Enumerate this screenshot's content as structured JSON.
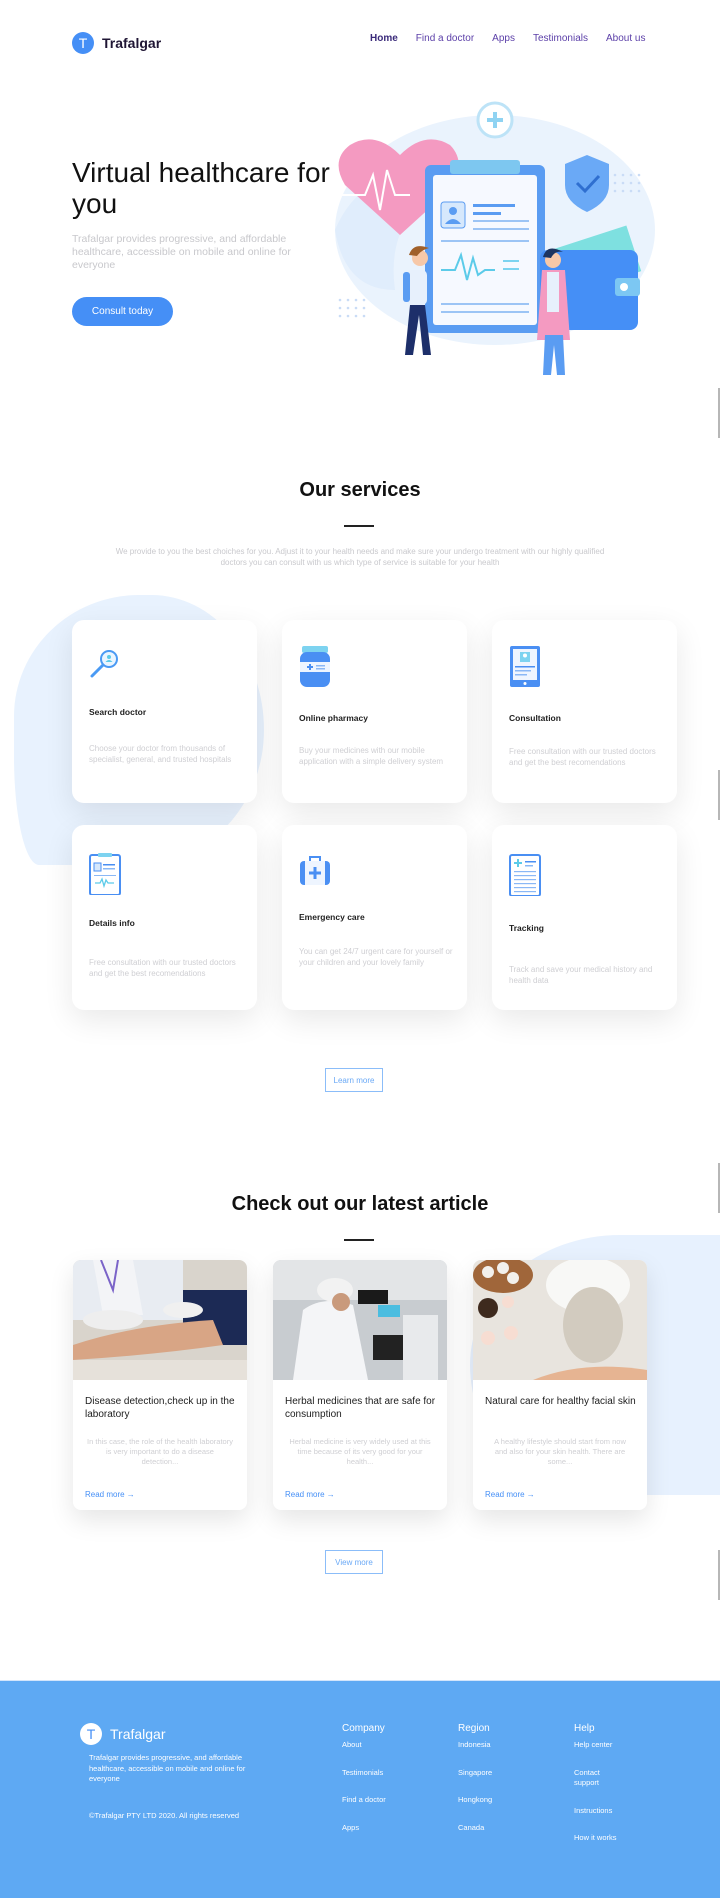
{
  "header": {
    "logo_letter": "T",
    "brand": "Trafalgar",
    "nav": [
      {
        "label": "Home",
        "active": true
      },
      {
        "label": "Find a doctor",
        "active": false
      },
      {
        "label": "Apps",
        "active": false
      },
      {
        "label": "Testimonials",
        "active": false
      },
      {
        "label": "About us",
        "active": false
      }
    ]
  },
  "hero": {
    "title": "Virtual healthcare for you",
    "subtitle": "Trafalgar provides progressive, and affordable healthcare, accessible on mobile and online for everyone",
    "cta": "Consult today",
    "illustration": "doctor-and-patient-clipboard-illustration"
  },
  "services": {
    "title": "Our services",
    "description": "We provide to you the best choiches for you. Adjust it to your health needs and make sure your undergo treatment with our highly qualified doctors you can consult with us which type of service is suitable for your health",
    "cards": [
      {
        "icon": "search-doctor-icon",
        "title": "Search doctor",
        "desc": "Choose your doctor from thousands of specialist, general, and trusted hospitals"
      },
      {
        "icon": "pharmacy-bottle-icon",
        "title": "Online pharmacy",
        "desc": "Buy your medicines with our mobile application with a simple delivery system"
      },
      {
        "icon": "tablet-consultation-icon",
        "title": "Consultation",
        "desc": "Free consultation with our trusted doctors and get the best recomendations"
      },
      {
        "icon": "clipboard-info-icon",
        "title": "Details info",
        "desc": "Free consultation with our trusted doctors and get the best recomendations"
      },
      {
        "icon": "medical-kit-icon",
        "title": "Emergency care",
        "desc": "You can get 24/7 urgent care for yourself or your children and your lovely family"
      },
      {
        "icon": "document-tracking-icon",
        "title": "Tracking",
        "desc": "Track and save your medical history and health data"
      }
    ],
    "learn_more": "Learn more"
  },
  "articles": {
    "title": "Check out our latest article",
    "items": [
      {
        "image": "lab-blood-test-photo",
        "title": "Disease detection,check up in the laboratory",
        "desc": "In this case, the role of the health laboratory is very important to do a disease detection...",
        "link": "Read more →"
      },
      {
        "image": "microscope-scientist-photo",
        "title": "Herbal medicines that are safe for consumption",
        "desc": "Herbal medicine is very widely used at this time because of its very good for your health...",
        "link": "Read more →"
      },
      {
        "image": "facial-mask-spa-photo",
        "title": "Natural care for healthy facial skin",
        "desc": "A healthy lifestyle should start from now and also for your skin health. There are some...",
        "link": "Read more →"
      }
    ],
    "view_more": "View more"
  },
  "footer": {
    "logo_letter": "T",
    "brand": "Trafalgar",
    "desc": "Trafalgar provides progressive, and affordable healthcare, accessible on mobile and online for everyone",
    "copyright": "©Trafalgar PTY LTD 2020. All rights reserved",
    "columns": [
      {
        "heading": "Company",
        "items": [
          "About",
          "Testimonials",
          "Find a doctor",
          "Apps"
        ]
      },
      {
        "heading": "Region",
        "items": [
          "Indonesia",
          "Singapore",
          "Hongkong",
          "Canada"
        ]
      },
      {
        "heading": "Help",
        "items": [
          "Help center",
          "Contact support",
          "Instructions",
          "How it works"
        ]
      }
    ]
  },
  "colors": {
    "primary": "#458ff6",
    "nav_link": "#5b3fa8",
    "footer_bg": "#5ea9f3",
    "muted_text": "#c9c9cd"
  }
}
